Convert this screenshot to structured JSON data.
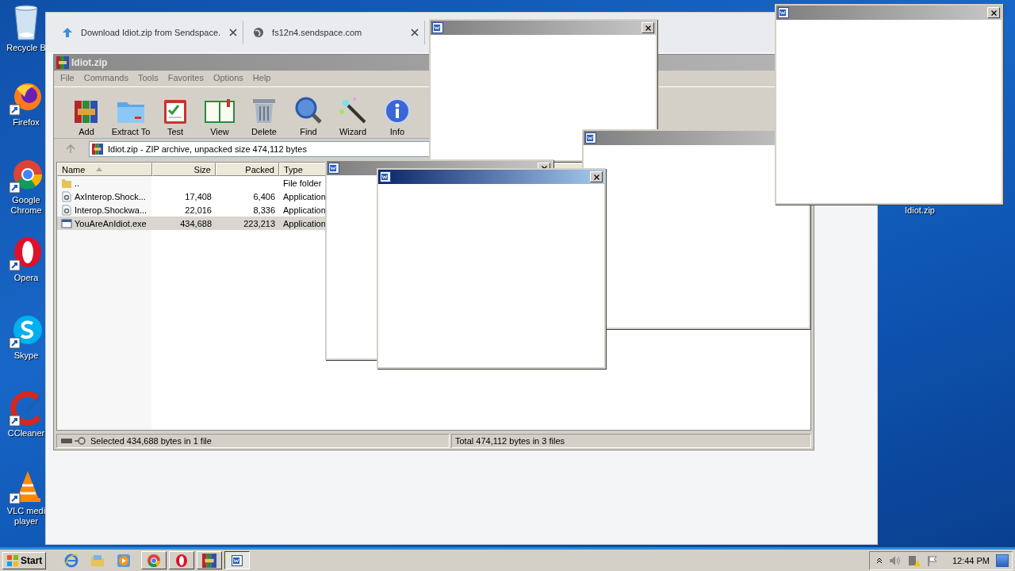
{
  "desktop_icons": [
    {
      "kind": "recycle",
      "label": "Recycle B"
    },
    {
      "kind": "firefox",
      "label": "Firefox"
    },
    {
      "kind": "chrome",
      "label": "Google Chrome"
    },
    {
      "kind": "opera",
      "label": "Opera"
    },
    {
      "kind": "skype",
      "label": "Skype"
    },
    {
      "kind": "ccleaner",
      "label": "CCleaner"
    },
    {
      "kind": "vlc",
      "label": "VLC medi player"
    }
  ],
  "desktop_file": {
    "label": "Idiot.zip"
  },
  "browser": {
    "tabs": [
      {
        "kind": "download",
        "title": "Download Idiot.zip from Sendspace."
      },
      {
        "kind": "globe",
        "title": "fs12n4.sendspace.com"
      }
    ]
  },
  "archiver": {
    "title": "Idiot.zip",
    "menu": [
      "File",
      "Commands",
      "Tools",
      "Favorites",
      "Options",
      "Help"
    ],
    "toolbar": [
      {
        "kind": "add",
        "label": "Add"
      },
      {
        "kind": "extract",
        "label": "Extract To"
      },
      {
        "kind": "test",
        "label": "Test"
      },
      {
        "kind": "view",
        "label": "View"
      },
      {
        "kind": "delete",
        "label": "Delete"
      },
      {
        "kind": "find",
        "label": "Find"
      },
      {
        "kind": "wizard",
        "label": "Wizard"
      },
      {
        "kind": "info",
        "label": "Info"
      }
    ],
    "path": "Idiot.zip - ZIP archive, unpacked size 474,112 bytes",
    "columns": [
      {
        "label": "Name",
        "sorted": true
      },
      {
        "label": "Size",
        "sorted": false
      },
      {
        "label": "Packed",
        "sorted": false
      },
      {
        "label": "Type",
        "sorted": false
      }
    ],
    "rows": [
      {
        "kind": "folder",
        "name": "..",
        "type": "File folder",
        "selected": false
      },
      {
        "kind": "dll",
        "name": "AxInterop.Shock...",
        "size": "17,408",
        "packed": "6,406",
        "type": "Application",
        "selected": false
      },
      {
        "kind": "dll",
        "name": "Interop.Shockwa...",
        "size": "22,016",
        "packed": "8,336",
        "type": "Application",
        "selected": false
      },
      {
        "kind": "exe",
        "name": "YouAreAnIdiot.exe",
        "size": "434,688",
        "packed": "223,213",
        "type": "Application",
        "selected": true
      }
    ],
    "status": [
      "Selected 434,688 bytes in 1 file",
      "Total 474,112 bytes in 3 files"
    ]
  },
  "popups": [
    {
      "active": false
    },
    {
      "active": false
    },
    {
      "active": false
    },
    {
      "active": true
    },
    {
      "active": false
    }
  ],
  "taskbar": {
    "start": "Start",
    "buttons": [
      {
        "kind": "ie",
        "pressed": false
      },
      {
        "kind": "explorer",
        "pressed": false
      },
      {
        "kind": "media",
        "pressed": false
      },
      {
        "kind": "chrome",
        "pressed": false
      },
      {
        "kind": "opera",
        "pressed": false
      },
      {
        "kind": "winrar",
        "pressed": false
      },
      {
        "kind": "word",
        "pressed": true
      }
    ],
    "clock": "12:44 PM"
  }
}
